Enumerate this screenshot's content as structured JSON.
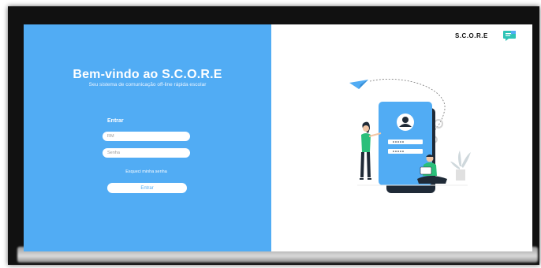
{
  "welcome": {
    "title": "Bem-vindo ao S.C.O.R.E",
    "subtitle": "Seu sistema de comunicação off-line rápida escolar"
  },
  "login": {
    "label": "Entrar",
    "rm_placeholder": "RM",
    "password_placeholder": "Senha",
    "forgot_label": "Esqueci minha senha",
    "submit_label": "Entrar"
  },
  "brand": {
    "name": "S.C.O.R.E",
    "icon": "chat-bubble-icon"
  },
  "colors": {
    "primary": "#51acf4",
    "background": "#ffffff",
    "frame": "#111111"
  }
}
